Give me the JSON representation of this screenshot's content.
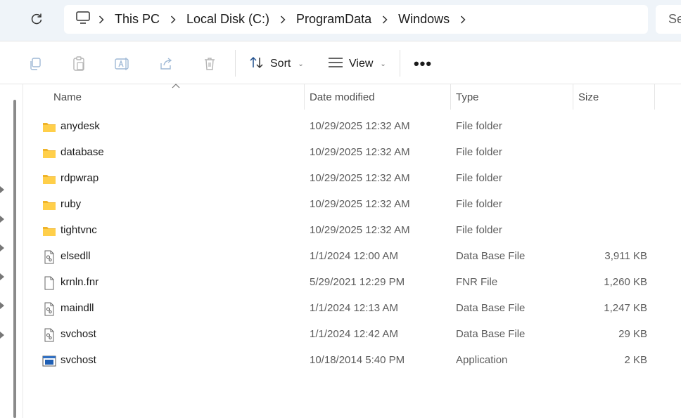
{
  "address": {
    "crumbs": [
      "This PC",
      "Local Disk (C:)",
      "ProgramData",
      "Windows"
    ],
    "search_placeholder": "Se"
  },
  "toolbar": {
    "sort_label": "Sort",
    "view_label": "View"
  },
  "columns": {
    "name": "Name",
    "date": "Date modified",
    "type": "Type",
    "size": "Size"
  },
  "files": [
    {
      "name": "anydesk",
      "date": "10/29/2025 12:32 AM",
      "type": "File folder",
      "size": "",
      "icon": "folder-icon"
    },
    {
      "name": "database",
      "date": "10/29/2025 12:32 AM",
      "type": "File folder",
      "size": "",
      "icon": "folder-icon"
    },
    {
      "name": "rdpwrap",
      "date": "10/29/2025 12:32 AM",
      "type": "File folder",
      "size": "",
      "icon": "folder-icon"
    },
    {
      "name": "ruby",
      "date": "10/29/2025 12:32 AM",
      "type": "File folder",
      "size": "",
      "icon": "folder-icon"
    },
    {
      "name": "tightvnc",
      "date": "10/29/2025 12:32 AM",
      "type": "File folder",
      "size": "",
      "icon": "folder-icon"
    },
    {
      "name": "elsedll",
      "date": "1/1/2024 12:00 AM",
      "type": "Data Base File",
      "size": "3,911 KB",
      "icon": "settings-file-icon"
    },
    {
      "name": "krnln.fnr",
      "date": "5/29/2021 12:29 PM",
      "type": "FNR File",
      "size": "1,260 KB",
      "icon": "blank-file-icon"
    },
    {
      "name": "maindll",
      "date": "1/1/2024 12:13 AM",
      "type": "Data Base File",
      "size": "1,247 KB",
      "icon": "settings-file-icon"
    },
    {
      "name": "svchost",
      "date": "1/1/2024 12:42 AM",
      "type": "Data Base File",
      "size": "29 KB",
      "icon": "settings-file-icon"
    },
    {
      "name": "svchost",
      "date": "10/18/2014 5:40 PM",
      "type": "Application",
      "size": "2 KB",
      "icon": "application-icon"
    }
  ]
}
